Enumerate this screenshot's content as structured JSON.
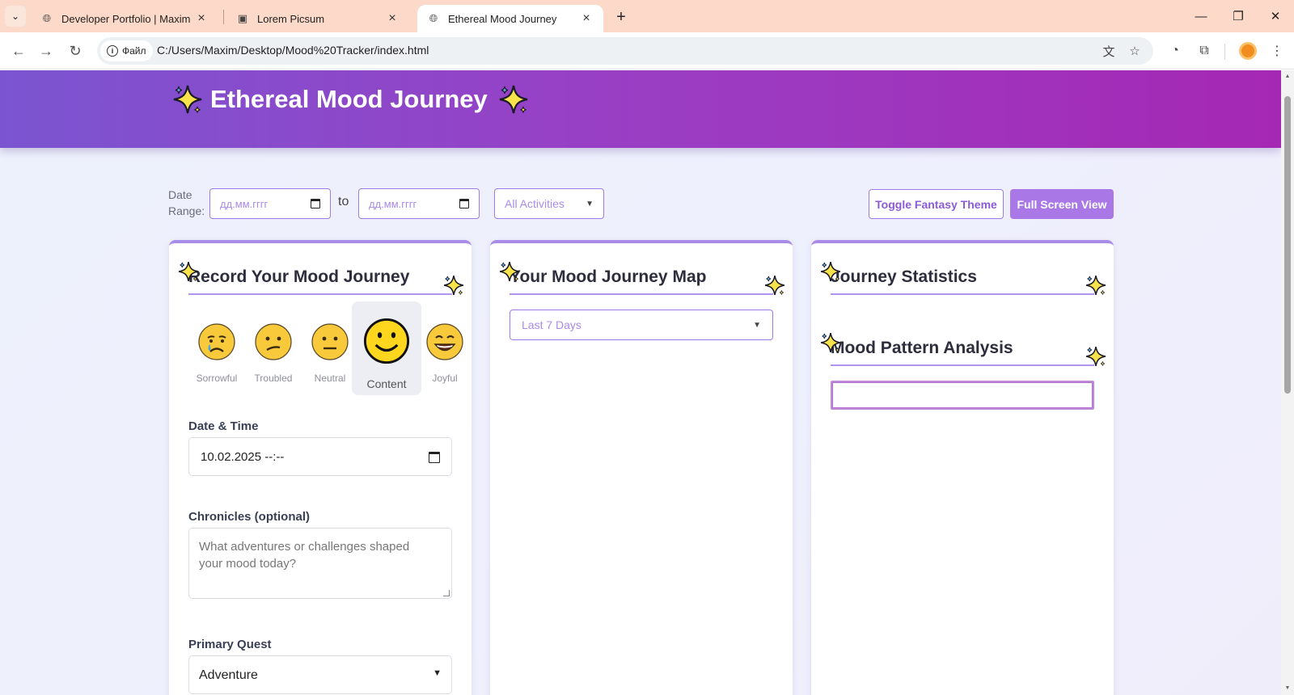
{
  "browser": {
    "tabs": [
      {
        "title": "Developer Portfolio | Maxim Mk",
        "favicon": "globe-icon",
        "active": false
      },
      {
        "title": "Lorem Picsum",
        "favicon": "image-icon",
        "active": false
      },
      {
        "title": "Ethereal Mood Journey",
        "favicon": "globe-icon",
        "active": true
      }
    ],
    "site_chip": "Файл",
    "url": "C:/Users/Maxim/Desktop/Mood%20Tracker/index.html"
  },
  "header": {
    "title": "Ethereal Mood Journey",
    "sparkle": "✨"
  },
  "filters": {
    "date_range_label_1": "Date",
    "date_range_label_2": "Range:",
    "date_from_placeholder": "дд.мм.гггг",
    "to_text": "to",
    "date_to_placeholder": "дд.мм.гггг",
    "activity_selected": "All Activities",
    "toggle_theme_label": "Toggle Fantasy Theme",
    "fullscreen_label": "Full Screen View"
  },
  "record_card": {
    "heading": "Record Your Mood Journey",
    "moods": [
      {
        "label": "Sorrowful",
        "face": "crying-face"
      },
      {
        "label": "Troubled",
        "face": "confused-face"
      },
      {
        "label": "Neutral",
        "face": "neutral-face"
      },
      {
        "label": "Content",
        "face": "smiling-face",
        "selected": true
      },
      {
        "label": "Joyful",
        "face": "grinning-face"
      }
    ],
    "datetime_label": "Date & Time",
    "datetime_value": "10.02.2025  --:--",
    "notes_label": "Chronicles (optional)",
    "notes_placeholder": "What adventures or challenges shaped your mood today?",
    "quest_label": "Primary Quest",
    "quest_selected": "Adventure"
  },
  "map_card": {
    "heading": "Your Mood Journey Map",
    "range_selected": "Last 7 Days"
  },
  "stats_card": {
    "heading": "Journey Statistics",
    "analysis_heading": "Mood Pattern Analysis"
  },
  "colors": {
    "accent": "#a98be8",
    "hero_start": "#7b55d1",
    "hero_end": "#a528b4",
    "emoji_yellow": "#f8c93a"
  }
}
